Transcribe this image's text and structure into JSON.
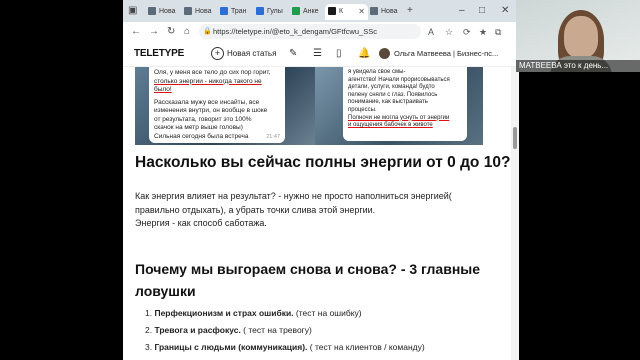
{
  "browser": {
    "tabs": [
      {
        "label": "Нова",
        "fav_color": "#5b6b7a",
        "active": false
      },
      {
        "label": "Нова",
        "fav_color": "#5b6b7a",
        "active": false
      },
      {
        "label": "Тран",
        "fav_color": "#2b6fd6",
        "active": false
      },
      {
        "label": "Гулы",
        "fav_color": "#2b6fd6",
        "active": false
      },
      {
        "label": "Анке",
        "fav_color": "#1e9e4a",
        "active": false
      },
      {
        "label": "К",
        "fav_color": "#1a1a1a",
        "active": true
      },
      {
        "label": "Нова",
        "fav_color": "#5b6b7a",
        "active": false
      }
    ],
    "url": "https://teletype.in/@eto_k_dengam/GFtfcwu_SSc"
  },
  "site_header": {
    "logo": "TELETYPE",
    "new_article": "Новая статья",
    "user_name": "Ольга Матвеева | Бизнес-пс..."
  },
  "article": {
    "image_left_text": [
      "Оля, у меня все тело до сих пор горит,",
      "столько энергии - никогда такого не",
      "было!",
      "",
      "Рассказала мужу все инсайты, все",
      "изменения внутри, он вообще в шоке",
      "от результата, говорит это 100%",
      "скачок на метр выше головы)",
      "Сильная сегодня была встреча"
    ],
    "image_left_time": "21:47",
    "image_right_text": [
      "я увидела свое смы-",
      "агентство! Начали прорисовываться",
      "детали, услуги, команда! будто",
      "пелену сняли с глаз. Появилось",
      "понимание, как выстраивать",
      "процессы.",
      "Полночи не могла уснуть от энергии",
      "и ощущения бабочек в животе"
    ],
    "heading1": "Насколько вы сейчас полны энергии от 0 до 10?",
    "para1": "Как энергия влияет на результат? - нужно не просто наполниться энергией(",
    "para2": "правильно отдыхать), а убрать точки слива этой энергии.",
    "para3": "Энергия -  как способ саботажа.",
    "heading2_line1": "Почему мы выгораем снова и снова? -  3 главные",
    "heading2_line2": "ловушки",
    "list": [
      {
        "num": "1.",
        "bold": "Перфекционизм и страх ошибки.",
        "rest": " (тест на ошибку)"
      },
      {
        "num": "2.",
        "bold": "Тревога и расфокус.",
        "rest": " ( тест на тревогу)"
      },
      {
        "num": "3.",
        "bold": "Границы с людьми (коммуникация).",
        "rest": " ( тест на клиентов / команду)"
      }
    ]
  },
  "webcam": {
    "label": "МАТВЕЕВА это к день..."
  }
}
